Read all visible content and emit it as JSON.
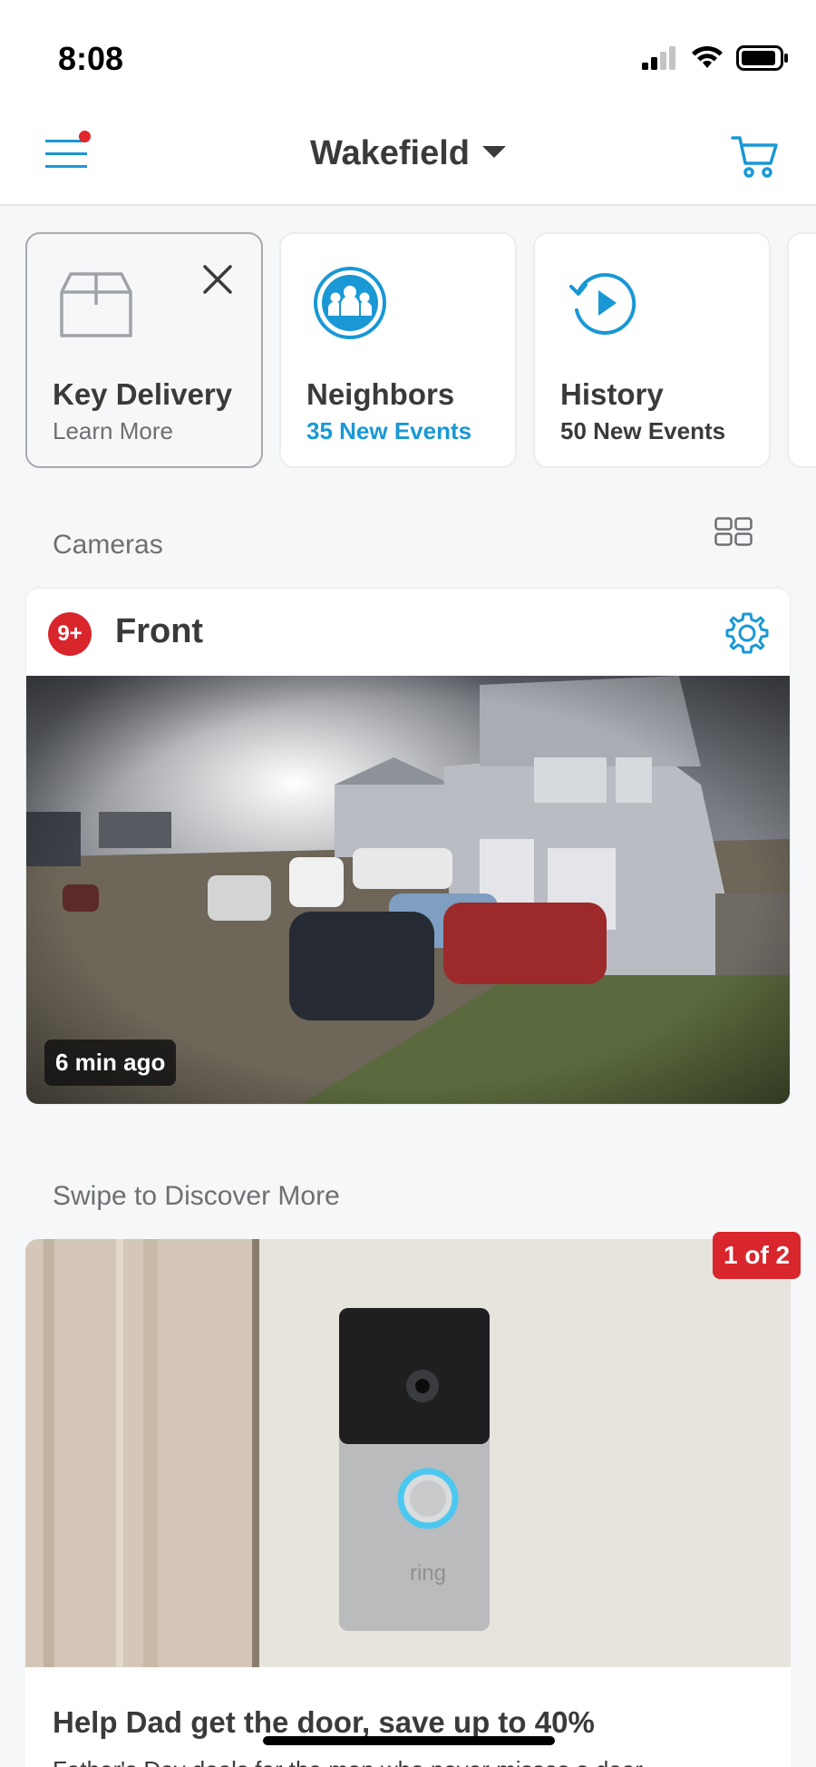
{
  "status_bar": {
    "time": "8:08"
  },
  "header": {
    "location": "Wakefield"
  },
  "tiles": [
    {
      "title": "Key Delivery",
      "subtitle": "Learn More"
    },
    {
      "title": "Neighbors",
      "subtitle": "35 New Events"
    },
    {
      "title": "History",
      "subtitle": "50 New Events"
    }
  ],
  "cameras": {
    "section_label": "Cameras",
    "items": [
      {
        "badge": "9+",
        "name": "Front",
        "last_seen": "6 min ago"
      }
    ]
  },
  "discover": {
    "section_label": "Swipe to Discover More",
    "pager": "1 of 2",
    "title": "Help Dad get the door, save up to 40%",
    "text": "Father's Day deals for the man who never misses a door",
    "product_brand": "ring"
  },
  "colors": {
    "accent_blue": "#1998d5",
    "alert_red": "#d8262c",
    "text_dark": "#3a3a3a",
    "text_muted": "#6d7073",
    "background": "#f6f7f8"
  },
  "icons": [
    "hamburger-menu-icon",
    "chevron-down-icon",
    "cart-icon",
    "package-icon",
    "close-icon",
    "neighbors-icon",
    "history-icon",
    "grid-view-icon",
    "gear-icon"
  ]
}
